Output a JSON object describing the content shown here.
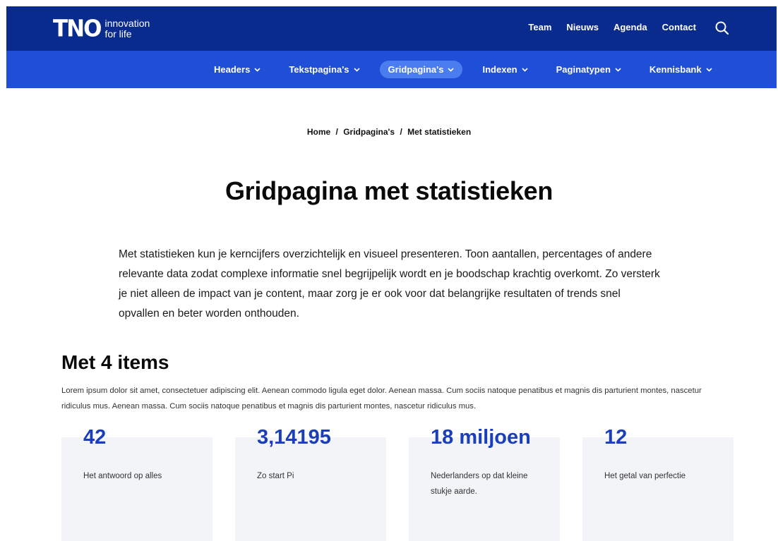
{
  "header": {
    "logo": {
      "brand": "TNO",
      "tagline_line1": "innovation",
      "tagline_line2": "for life"
    },
    "top_links": [
      "Team",
      "Nieuws",
      "Agenda",
      "Contact"
    ],
    "search_icon": "search-icon"
  },
  "nav": {
    "items": [
      {
        "label": "Headers",
        "active": false
      },
      {
        "label": "Tekstpagina's",
        "active": false
      },
      {
        "label": "Gridpagina's",
        "active": true
      },
      {
        "label": "Indexen",
        "active": false
      },
      {
        "label": "Paginatypen",
        "active": false
      },
      {
        "label": "Kennisbank",
        "active": false
      }
    ]
  },
  "breadcrumb": {
    "items": [
      "Home",
      "Gridpagina's",
      "Met statistieken"
    ],
    "separator": "/"
  },
  "page": {
    "title": "Gridpagina met statistieken",
    "intro": "Met statistieken kun je kerncijfers overzichtelijk en visueel presenteren. Toon aantallen, percentages of andere relevante data zodat complexe informatie snel begrijpelijk wordt en je boodschap krachtig overkomt. Zo versterk je niet alleen de impact van je content, maar zorg je er ook voor dat belangrijke resultaten of trends snel opvallen en beter worden onthouden."
  },
  "section": {
    "title": "Met 4 items",
    "text": "Lorem ipsum dolor sit amet, consectetuer adipiscing elit. Aenean commodo ligula eget dolor. Aenean massa. Cum sociis natoque penatibus et magnis dis parturient montes, nascetur ridiculus mus. Aenean massa. Cum sociis natoque penatibus et magnis dis parturient montes, nascetur ridiculus mus.",
    "stats": [
      {
        "value": "42",
        "label": "Het antwoord op alles"
      },
      {
        "value": "3,14195",
        "label": "Zo start Pi"
      },
      {
        "value": "18 miljoen",
        "label": "Nederlanders op dat kleine stukje aarde."
      },
      {
        "value": "12",
        "label": "Het getal van perfectie"
      }
    ]
  },
  "colors": {
    "topbar": "#0a2b8e",
    "navbar": "#1f4fd6",
    "nav_active": "#4a7df0",
    "stat_value": "#1a3fb8",
    "card_bg": "#f2f4f8"
  }
}
